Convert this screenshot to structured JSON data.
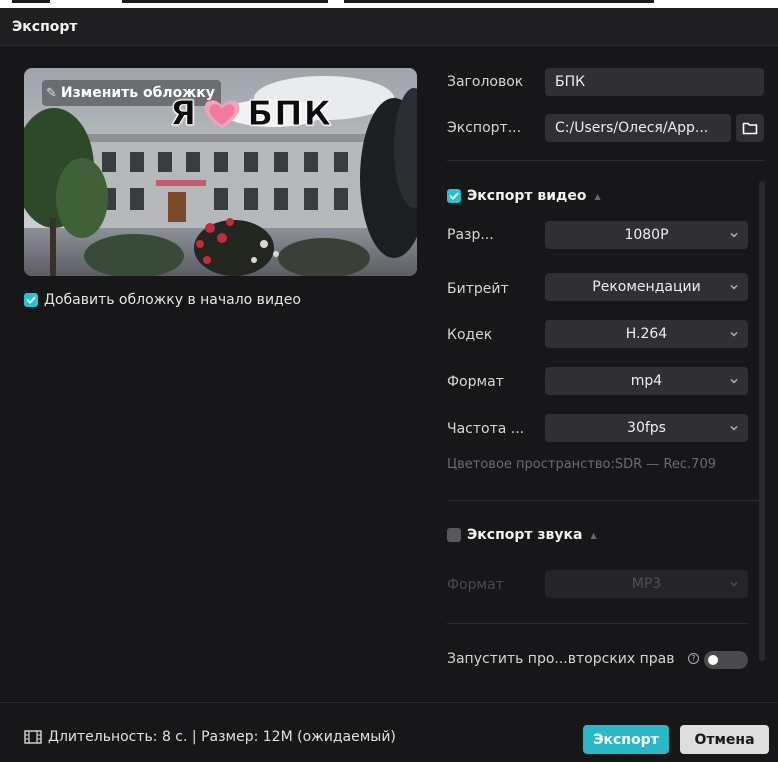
{
  "dialog": {
    "title": "Экспорт"
  },
  "cover": {
    "edit_label": "Изменить обложку",
    "overlay_text_left": "Я",
    "overlay_text_right": "БПК",
    "heart_icon": "pink-heart-icon"
  },
  "add_cover": {
    "label": "Добавить обложку в начало видео",
    "checked": true
  },
  "general": {
    "title_label": "Заголовок",
    "title_value": "БПК",
    "export_label": "Экспорт...",
    "export_path": "C:/Users/Олеся/App...",
    "folder_icon": "folder-icon"
  },
  "video": {
    "section_label": "Экспорт видео",
    "enabled": true,
    "rows": [
      {
        "label": "Разр...",
        "value": "1080P"
      },
      {
        "label": "Битрейт",
        "value": "Рекомендации"
      },
      {
        "label": "Кодек",
        "value": "H.264"
      },
      {
        "label": "Формат",
        "value": "mp4"
      },
      {
        "label": "Частота ...",
        "value": "30fps"
      }
    ],
    "color_space": "Цветовое пространство:SDR — Rec.709"
  },
  "audio": {
    "section_label": "Экспорт звука",
    "enabled": false,
    "format_label": "Формат",
    "format_value": "MP3"
  },
  "copyright": {
    "label": "Запустить про...вторских прав",
    "help_icon": "help-icon",
    "toggle_on": false
  },
  "footer": {
    "info": "Длительность: 8 с. | Размер: 12M (ожидаемый)",
    "film_icon": "film-icon",
    "export_button": "Экспорт",
    "cancel_button": "Отмена"
  },
  "colors": {
    "accent": "#2ab8c6",
    "background": "#17171a",
    "field": "#303034"
  }
}
